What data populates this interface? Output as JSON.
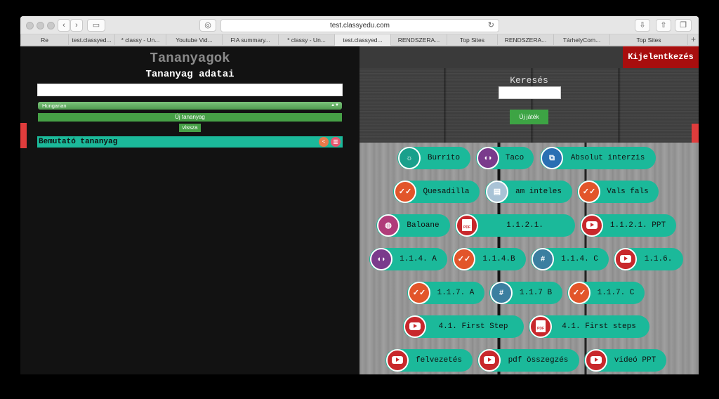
{
  "browser": {
    "url": "test.classyedu.com",
    "tabs": [
      "Re",
      "test.classyed...",
      "* classy - Un...",
      "Youtube Vid...",
      "FIA summary...",
      "* classy - Un...",
      "test.classyed...",
      "RENDSZERA...",
      "Top Sites",
      "RENDSZERA...",
      "TárhelyCom...",
      "Top Sites"
    ],
    "active_tab": 6,
    "new_tab_label": "+"
  },
  "left": {
    "title": "Tananyagok",
    "subtitle": "Tananyag adatai",
    "name_value": "",
    "language": "Hungarian",
    "new_material_label": "Új tananyag",
    "back_label": "vissza",
    "materials": [
      {
        "label": "Bemutató tananyag"
      }
    ]
  },
  "right": {
    "logout_label": "Kijelentkezés",
    "search_title": "Keresés",
    "search_value": "",
    "new_game_label": "Új játék",
    "games": [
      {
        "label": "Burrito",
        "icon": "sun-icon"
      },
      {
        "label": "Taco",
        "icon": "fish-icon"
      },
      {
        "label": "Absolut interzis",
        "icon": "puzzle-icon"
      },
      {
        "label": "Quesadilla",
        "icon": "check-icon"
      },
      {
        "label": "am inteles",
        "icon": "book-icon"
      },
      {
        "label": "Vals fals",
        "icon": "check-icon"
      },
      {
        "label": "Baloane",
        "icon": "balloon-icon"
      },
      {
        "label": "1.1.2.1.",
        "icon": "pdf-icon"
      },
      {
        "label": "1.1.2.1. PPT",
        "icon": "video-icon"
      },
      {
        "label": "1.1.4. A",
        "icon": "fish-icon"
      },
      {
        "label": "1.1.4.B",
        "icon": "check-icon"
      },
      {
        "label": "1.1.4. C",
        "icon": "grid-icon"
      },
      {
        "label": "1.1.6.",
        "icon": "video-icon"
      },
      {
        "label": "1.1.7. A",
        "icon": "check-icon"
      },
      {
        "label": "1.1.7 B",
        "icon": "grid-icon"
      },
      {
        "label": "1.1.7. C",
        "icon": "check-icon"
      },
      {
        "label": "4.1. First Step",
        "icon": "video-icon"
      },
      {
        "label": "4.1. First steps",
        "icon": "pdf-icon"
      },
      {
        "label": "felvezetés",
        "icon": "video-icon"
      },
      {
        "label": "pdf összegzés",
        "icon": "video-icon"
      },
      {
        "label": "videó PPT",
        "icon": "video-icon"
      }
    ],
    "pdf_text": "PDF"
  },
  "colors": {
    "teal": "#1bb99a",
    "green": "#46a046",
    "logout_red": "#a80e0e",
    "tab_red": "#e03c3c"
  }
}
